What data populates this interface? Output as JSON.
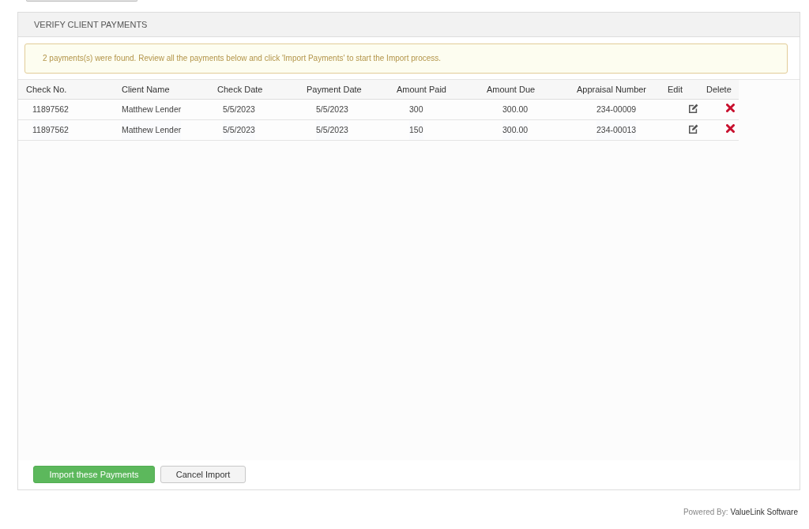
{
  "panel": {
    "title": "VERIFY CLIENT PAYMENTS",
    "alert": "2 payments(s) were found. Review all the payments below and click 'Import Payments' to start the Import process.",
    "table": {
      "columns": [
        "Check No.",
        "Client Name",
        "Check Date",
        "Payment Date",
        "Amount Paid",
        "Amount Due",
        "Appraisal Number",
        "Edit",
        "Delete"
      ],
      "rows": [
        {
          "cells": [
            "11897562",
            "Matthew Lender",
            "5/5/2023",
            "5/5/2023",
            "300",
            "300.00",
            "234-00009"
          ]
        },
        {
          "cells": [
            "11897562",
            "Matthew Lender",
            "5/5/2023",
            "5/5/2023",
            "150",
            "300.00",
            "234-00013"
          ]
        }
      ]
    },
    "buttons": [
      {
        "label": "Import these Payments",
        "kind": "primary"
      },
      {
        "label": "Cancel Import",
        "kind": "default"
      }
    ]
  },
  "footer": {
    "label": "Powered By:",
    "brand": "ValueLink Software"
  }
}
